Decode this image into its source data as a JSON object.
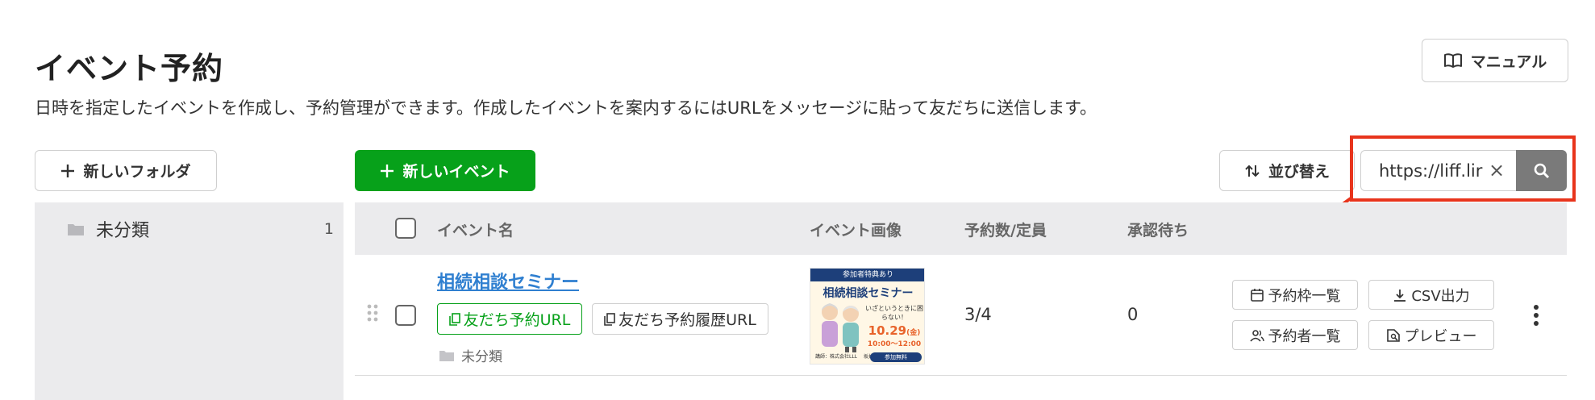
{
  "header": {
    "title": "イベント予約",
    "description": "日時を指定したイベントを作成し、予約管理ができます。作成したイベントを案内するにはURLをメッセージに貼って友だちに送信します。",
    "manual_label": "マニュアル"
  },
  "toolbar": {
    "new_folder_label": "新しいフォルダ",
    "new_event_label": "新しいイベント",
    "sort_label": "並び替え",
    "search_value": "https://liff.lir",
    "clear_glyph": "×"
  },
  "sidebar": {
    "items": [
      {
        "label": "未分類",
        "count": "1"
      }
    ]
  },
  "table": {
    "columns": {
      "name": "イベント名",
      "image": "イベント画像",
      "reservations": "予約数/定員",
      "pending": "承認待ち"
    },
    "rows": [
      {
        "name": "相続相談セミナー",
        "friend_url_label": "友だち予約URL",
        "history_url_label": "友だち予約履歴URL",
        "folder": "未分類",
        "reservations": "3/4",
        "pending": "0",
        "image": {
          "banner": "参加者特典あり",
          "title": "相続相談セミナー",
          "subtitle": "いざというときに困らない！",
          "date": "10.29",
          "day": "(金)",
          "time": "10:00〜12:00",
          "speaker": "講師：株式会社LLL 　坂井 直樹",
          "free": "参加無料"
        },
        "actions": {
          "slots": "予約枠一覧",
          "csv": "CSV出力",
          "reservers": "予約者一覧",
          "preview": "プレビュー"
        }
      }
    ]
  },
  "colors": {
    "primary_green": "#07a11a",
    "link_blue": "#2f7fd0",
    "highlight_red": "#e8341c",
    "header_gray": "#ebebed"
  }
}
